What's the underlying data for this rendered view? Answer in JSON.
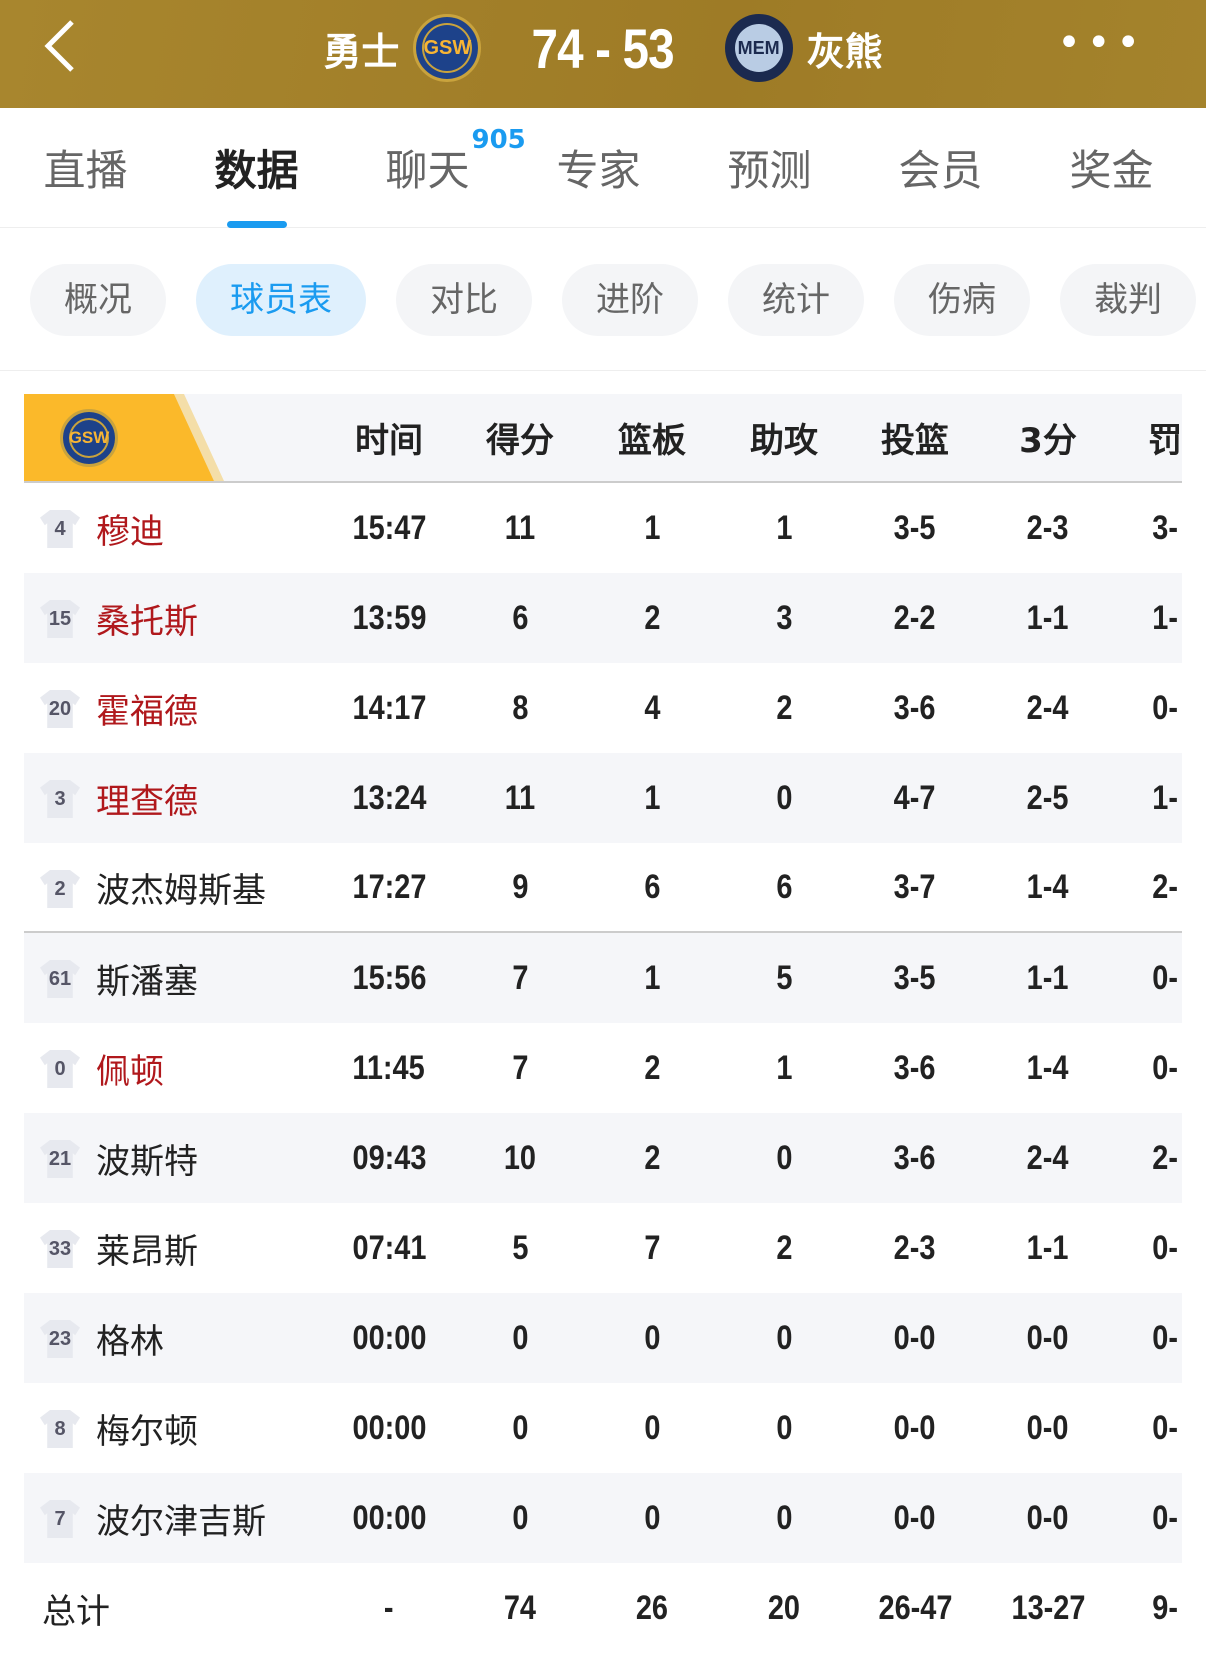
{
  "header": {
    "home": "勇士",
    "home_abbr": "GSW",
    "score": "74 - 53",
    "away": "灰熊",
    "away_abbr": "MEM",
    "more": "•••"
  },
  "tabs": [
    {
      "label": "直播"
    },
    {
      "label": "数据",
      "active": true
    },
    {
      "label": "聊天",
      "badge": "905"
    },
    {
      "label": "专家"
    },
    {
      "label": "预测"
    },
    {
      "label": "会员"
    },
    {
      "label": "奖金"
    }
  ],
  "subtabs": [
    {
      "label": "概况"
    },
    {
      "label": "球员表",
      "active": true
    },
    {
      "label": "对比"
    },
    {
      "label": "进阶"
    },
    {
      "label": "统计"
    },
    {
      "label": "伤病"
    },
    {
      "label": "裁判"
    }
  ],
  "table": {
    "team_abbr": "GSW",
    "columns": [
      "时间",
      "得分",
      "篮板",
      "助攻",
      "投篮",
      "3分",
      "罚"
    ],
    "rows": [
      {
        "no": "4",
        "name": "穆迪",
        "red": true,
        "v": [
          "15:47",
          "11",
          "1",
          "1",
          "3-5",
          "2-3",
          "3-"
        ]
      },
      {
        "no": "15",
        "name": "桑托斯",
        "red": true,
        "v": [
          "13:59",
          "6",
          "2",
          "3",
          "2-2",
          "1-1",
          "1-"
        ]
      },
      {
        "no": "20",
        "name": "霍福德",
        "red": true,
        "v": [
          "14:17",
          "8",
          "4",
          "2",
          "3-6",
          "2-4",
          "0-"
        ]
      },
      {
        "no": "3",
        "name": "理查德",
        "red": true,
        "v": [
          "13:24",
          "11",
          "1",
          "0",
          "4-7",
          "2-5",
          "1-"
        ]
      },
      {
        "no": "2",
        "name": "波杰姆斯基",
        "red": false,
        "v": [
          "17:27",
          "9",
          "6",
          "6",
          "3-7",
          "1-4",
          "2-"
        ]
      },
      {
        "no": "61",
        "name": "斯潘塞",
        "red": false,
        "v": [
          "15:56",
          "7",
          "1",
          "5",
          "3-5",
          "1-1",
          "0-"
        ]
      },
      {
        "no": "0",
        "name": "佩顿",
        "red": true,
        "v": [
          "11:45",
          "7",
          "2",
          "1",
          "3-6",
          "1-4",
          "0-"
        ]
      },
      {
        "no": "21",
        "name": "波斯特",
        "red": false,
        "v": [
          "09:43",
          "10",
          "2",
          "0",
          "3-6",
          "2-4",
          "2-"
        ]
      },
      {
        "no": "33",
        "name": "莱昂斯",
        "red": false,
        "v": [
          "07:41",
          "5",
          "7",
          "2",
          "2-3",
          "1-1",
          "0-"
        ]
      },
      {
        "no": "23",
        "name": "格林",
        "red": false,
        "v": [
          "00:00",
          "0",
          "0",
          "0",
          "0-0",
          "0-0",
          "0-"
        ]
      },
      {
        "no": "8",
        "name": "梅尔顿",
        "red": false,
        "v": [
          "00:00",
          "0",
          "0",
          "0",
          "0-0",
          "0-0",
          "0-"
        ]
      },
      {
        "no": "7",
        "name": "波尔津吉斯",
        "red": false,
        "v": [
          "00:00",
          "0",
          "0",
          "0",
          "0-0",
          "0-0",
          "0-"
        ]
      }
    ],
    "total": {
      "label": "总计",
      "v": [
        "-",
        "74",
        "26",
        "20",
        "26-47",
        "13-27",
        "9-"
      ]
    }
  }
}
